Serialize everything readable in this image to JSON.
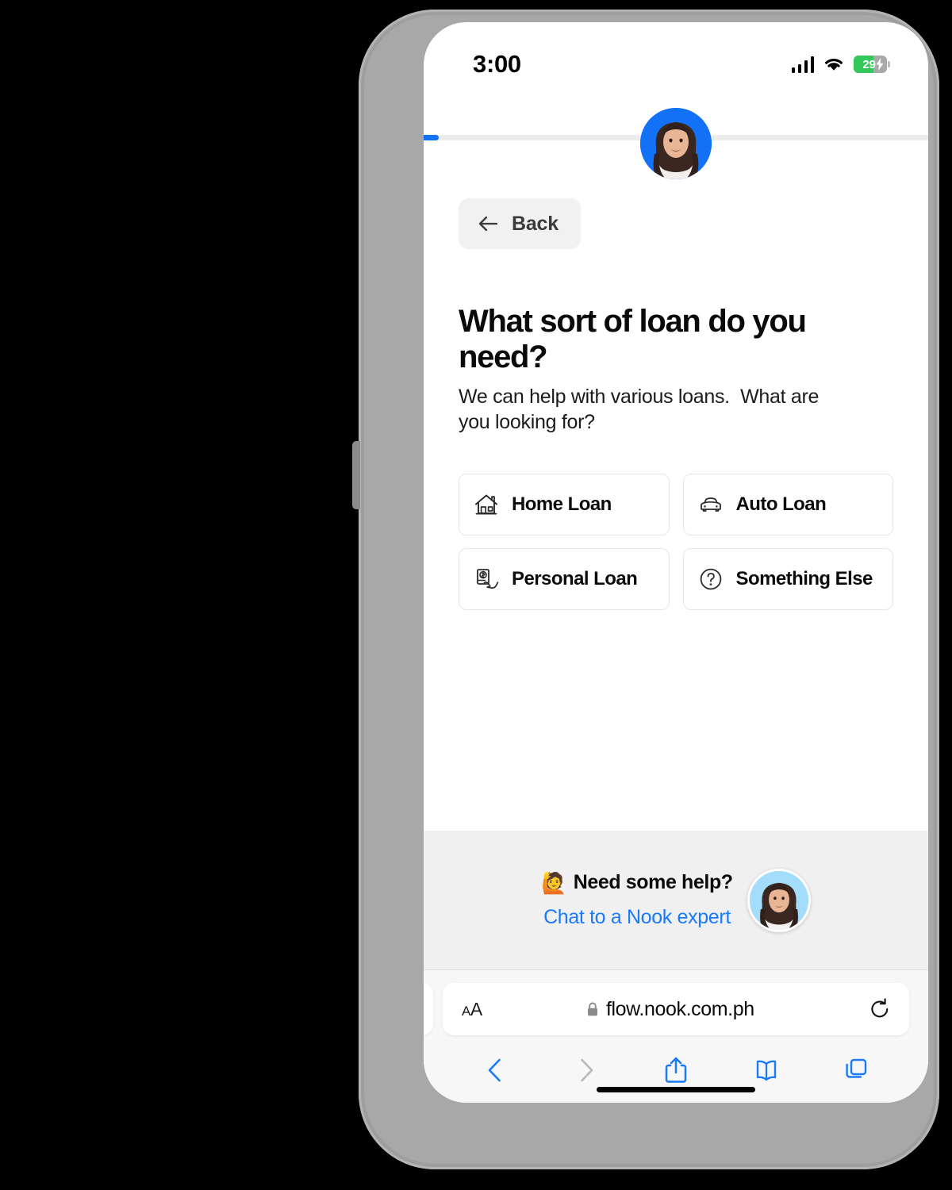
{
  "device": {
    "status_bar": {
      "time": "3:00",
      "signal_icon": "cellular-signal-icon",
      "wifi_icon": "wifi-icon",
      "battery_percent": "29",
      "battery_charging": true,
      "battery_color": "#34c759"
    },
    "home_indicator": "home-indicator"
  },
  "progress": {
    "percent": 3,
    "color": "#1371f7",
    "track_color": "#ececec"
  },
  "hero": {
    "avatar_alt": "Nook expert avatar",
    "avatar_bg": "#1371f7"
  },
  "nav": {
    "back_label": "Back",
    "back_icon": "arrow-left-icon"
  },
  "content": {
    "title": "What sort of loan do you need?",
    "subtitle": "We can help with various loans.  What are you looking for?",
    "options": [
      {
        "label": "Home Loan",
        "icon": "house-icon"
      },
      {
        "label": "Auto Loan",
        "icon": "car-icon"
      },
      {
        "label": "Personal Loan",
        "icon": "hand-holding-money-icon"
      },
      {
        "label": "Something Else",
        "icon": "question-circle-icon"
      }
    ]
  },
  "help": {
    "emoji": "🙋",
    "title": "Need some help?",
    "link_label": "Chat to a Nook expert",
    "link_color": "#1a7afb",
    "background": "#f0f0f0",
    "avatar_alt": "Nook expert avatar",
    "avatar_bg": "#a4dcfb"
  },
  "browser": {
    "text_size_label_small": "A",
    "text_size_label_large": "A",
    "lock_icon": "lock-icon",
    "url": "flow.nook.com.ph",
    "reload_icon": "reload-icon",
    "toolbar": [
      {
        "name": "back-icon",
        "enabled": true
      },
      {
        "name": "forward-icon",
        "enabled": false
      },
      {
        "name": "share-icon",
        "enabled": true
      },
      {
        "name": "bookmarks-icon",
        "enabled": true
      },
      {
        "name": "tabs-icon",
        "enabled": true
      }
    ],
    "accent_color": "#1a7afb"
  }
}
